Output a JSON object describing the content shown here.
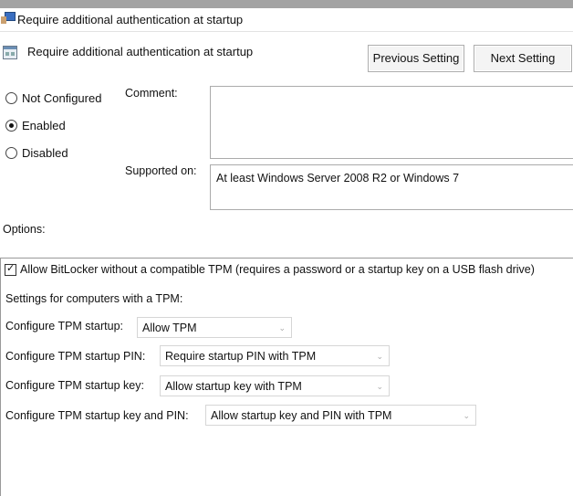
{
  "window": {
    "title": "Require additional authentication at startup"
  },
  "policy": {
    "name": "Require additional authentication at startup",
    "previous_label": "Previous Setting",
    "next_label": "Next Setting"
  },
  "state": {
    "options": [
      "Not Configured",
      "Enabled",
      "Disabled"
    ],
    "selected": "Enabled"
  },
  "comment": {
    "label": "Comment:",
    "value": ""
  },
  "supported": {
    "label": "Supported on:",
    "value": "At least Windows Server 2008 R2 or Windows 7"
  },
  "options": {
    "label": "Options:",
    "allow_without_tpm": {
      "label": "Allow BitLocker without a compatible TPM (requires a password or a startup key on a USB flash drive)",
      "checked": true
    },
    "tpm_heading": "Settings for computers with a TPM:",
    "selects": [
      {
        "label": "Configure TPM startup:",
        "value": "Allow TPM"
      },
      {
        "label": "Configure TPM startup PIN:",
        "value": "Require startup PIN with TPM"
      },
      {
        "label": "Configure TPM startup key:",
        "value": "Allow startup key with TPM"
      },
      {
        "label": "Configure TPM startup key and PIN:",
        "value": "Allow startup key and PIN with TPM"
      }
    ]
  }
}
